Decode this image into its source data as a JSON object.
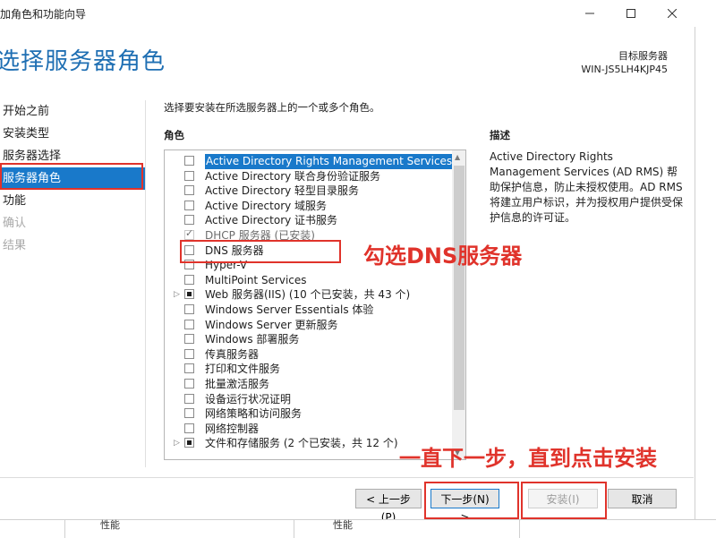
{
  "window": {
    "title": "添加角色和功能向导",
    "controls": {
      "minimize_icon": "minimize-icon",
      "maximize_icon": "maximize-icon",
      "close_icon": "close-icon"
    }
  },
  "page": {
    "heading": "选择服务器角色",
    "target_label": "目标服务器",
    "target_name": "WIN-JS5LH4KJP45"
  },
  "nav": {
    "items": [
      {
        "label": "开始之前",
        "state": "normal"
      },
      {
        "label": "安装类型",
        "state": "normal"
      },
      {
        "label": "服务器选择",
        "state": "normal"
      },
      {
        "label": "服务器角色",
        "state": "active"
      },
      {
        "label": "功能",
        "state": "normal"
      },
      {
        "label": "确认",
        "state": "disabled"
      },
      {
        "label": "结果",
        "state": "disabled"
      }
    ]
  },
  "main": {
    "instruction": "选择要安装在所选服务器上的一个或多个角色。",
    "roles_label": "角色",
    "description_label": "描述",
    "description_text": "Active Directory Rights Management Services (AD RMS) 帮助保护信息，防止未授权使用。AD RMS 将建立用户标识，并为授权用户提供受保护信息的许可证。",
    "roles": [
      {
        "label": "Active Directory Rights Management Services",
        "check": "none",
        "expander": false,
        "selected": true
      },
      {
        "label": "Active Directory 联合身份验证服务",
        "check": "none",
        "expander": false
      },
      {
        "label": "Active Directory 轻型目录服务",
        "check": "none",
        "expander": false
      },
      {
        "label": "Active Directory 域服务",
        "check": "none",
        "expander": false
      },
      {
        "label": "Active Directory 证书服务",
        "check": "none",
        "expander": false
      },
      {
        "label": "DHCP 服务器 (已安装)",
        "check": "checked",
        "expander": false
      },
      {
        "label": "DNS 服务器",
        "check": "none",
        "expander": false
      },
      {
        "label": "Hyper-V",
        "check": "none",
        "expander": false
      },
      {
        "label": "MultiPoint Services",
        "check": "none",
        "expander": false
      },
      {
        "label": "Web 服务器(IIS) (10 个已安装，共 43 个)",
        "check": "partial",
        "expander": true
      },
      {
        "label": "Windows Server Essentials 体验",
        "check": "none",
        "expander": false
      },
      {
        "label": "Windows Server 更新服务",
        "check": "none",
        "expander": false
      },
      {
        "label": "Windows 部署服务",
        "check": "none",
        "expander": false
      },
      {
        "label": "传真服务器",
        "check": "none",
        "expander": false
      },
      {
        "label": "打印和文件服务",
        "check": "none",
        "expander": false
      },
      {
        "label": "批量激活服务",
        "check": "none",
        "expander": false
      },
      {
        "label": "设备运行状况证明",
        "check": "none",
        "expander": false
      },
      {
        "label": "网络策略和访问服务",
        "check": "none",
        "expander": false
      },
      {
        "label": "网络控制器",
        "check": "none",
        "expander": false
      },
      {
        "label": "文件和存储服务 (2 个已安装，共 12 个)",
        "check": "partial",
        "expander": true
      }
    ]
  },
  "annotations": {
    "dns_hint": "勾选DNS服务器",
    "next_hint": "一直下一步，直到点击安装",
    "color": "#e0332b"
  },
  "footer": {
    "prev_label": "< 上一步(P)",
    "next_label": "下一步(N) >",
    "install_label": "安装(I)",
    "cancel_label": "取消"
  },
  "background_strip": {
    "col1": "性能",
    "col2": "性能"
  },
  "colors": {
    "accent": "#1979ca",
    "heading": "#1f6fb3",
    "annotation": "#e0332b"
  }
}
